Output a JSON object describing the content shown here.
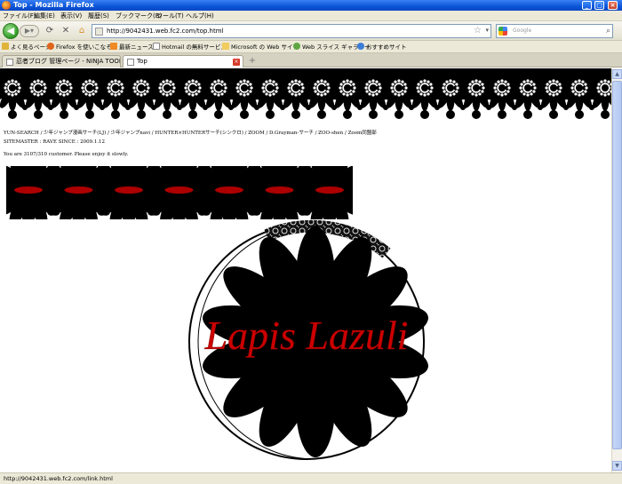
{
  "window": {
    "title": "Top - Mozilla Firefox",
    "minimize": "_",
    "maximize": "□",
    "close": "×"
  },
  "menu": [
    "ファイル(F)",
    "編集(E)",
    "表示(V)",
    "履歴(S)",
    "ブックマーク(B)",
    "ツール(T)",
    "ヘルプ(H)"
  ],
  "nav": {
    "url": "http://9042431.web.fc2.com/top.html",
    "search_placeholder": "Google"
  },
  "bookmarks": [
    {
      "label": "よく見るページ",
      "icon": "star-folder-icon",
      "color": "#e0b43a"
    },
    {
      "label": "Firefox を使いこなそう",
      "icon": "firefox-icon",
      "color": "#e0641c"
    },
    {
      "label": "最新ニュース",
      "icon": "rss-icon",
      "color": "#f08a24"
    },
    {
      "label": "Hotmail の無料サービス",
      "icon": "page-icon",
      "color": "#ffffff"
    },
    {
      "label": "Microsoft の Web サイト",
      "icon": "folder-icon",
      "color": "#f2cc5d"
    },
    {
      "label": "Web スライス ギャラリー",
      "icon": "globe-icon",
      "color": "#5da642"
    },
    {
      "label": "おすすめサイト",
      "icon": "ie-icon",
      "color": "#3b7dd8"
    }
  ],
  "tabs": [
    {
      "label": "忍者ブログ 管理ページ - NINJA TOOLS",
      "active": false
    },
    {
      "label": "Top",
      "active": true
    }
  ],
  "page": {
    "line1": "YUN-SEARCH / 少年ジャンプ漫画サーチ(LJ) / 少年ジャンプnavi / HUNTER×HUNTERサーチ(シンクロ) / ZOOM / D.Grayman-サーチ / ZOO-shen / Zoom同盟部",
    "line2": "SITEMASTER : RAVE SINCE : 2009.1.12",
    "line3": "You are 3107/310 customer. Please enjoy it slowly.",
    "logo_text": "Lapis Lazuli",
    "flower_count": 7,
    "accent_color": "#cc0000"
  },
  "status": {
    "text": "http://9042431.web.fc2.com/link.html"
  }
}
